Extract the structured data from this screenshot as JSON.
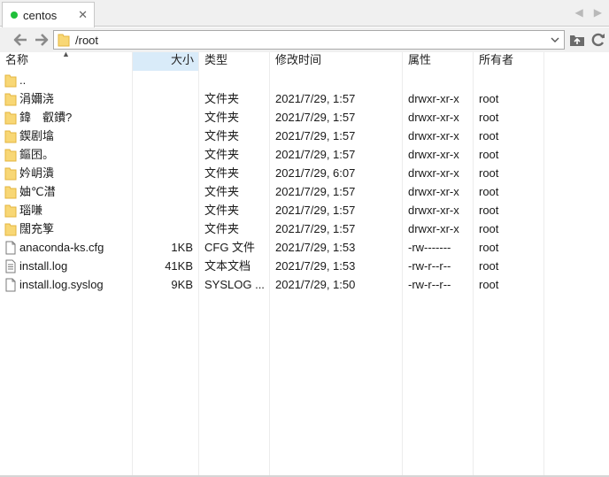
{
  "tab": {
    "title": "centos",
    "close": "✕",
    "status_color": "#1fbf3a"
  },
  "tab_nav": {
    "left": "◀",
    "right": "▶"
  },
  "address": {
    "path": "/root"
  },
  "columns": {
    "name": "名称",
    "size": "大小",
    "type": "类型",
    "mtime": "修改时间",
    "attr": "属性",
    "owner": "所有者"
  },
  "rows": [
    {
      "icon": "folder-icon",
      "name": "..",
      "size": "",
      "type": "",
      "mtime": "",
      "attr": "",
      "owner": ""
    },
    {
      "icon": "folder-icon",
      "name": "涓嬭浇",
      "size": "",
      "type": "文件夹",
      "mtime": "2021/7/29, 1:57",
      "attr": "drwxr-xr-x",
      "owner": "root"
    },
    {
      "icon": "folder-icon",
      "name": "鍏　叡鐨?",
      "size": "",
      "type": "文件夹",
      "mtime": "2021/7/29, 1:57",
      "attr": "drwxr-xr-x",
      "owner": "root"
    },
    {
      "icon": "folder-icon",
      "name": "鍥剧墖",
      "size": "",
      "type": "文件夹",
      "mtime": "2021/7/29, 1:57",
      "attr": "drwxr-xr-x",
      "owner": "root"
    },
    {
      "icon": "folder-icon",
      "name": "鏂囨。",
      "size": "",
      "type": "文件夹",
      "mtime": "2021/7/29, 1:57",
      "attr": "drwxr-xr-x",
      "owner": "root"
    },
    {
      "icon": "folder-icon",
      "name": "妗岄潰",
      "size": "",
      "type": "文件夹",
      "mtime": "2021/7/29, 6:07",
      "attr": "drwxr-xr-x",
      "owner": "root"
    },
    {
      "icon": "folder-icon",
      "name": "妯℃澘",
      "size": "",
      "type": "文件夹",
      "mtime": "2021/7/29, 1:57",
      "attr": "drwxr-xr-x",
      "owner": "root"
    },
    {
      "icon": "folder-icon",
      "name": "瑙嗛",
      "size": "",
      "type": "文件夹",
      "mtime": "2021/7/29, 1:57",
      "attr": "drwxr-xr-x",
      "owner": "root"
    },
    {
      "icon": "folder-icon",
      "name": "闊充箰",
      "size": "",
      "type": "文件夹",
      "mtime": "2021/7/29, 1:57",
      "attr": "drwxr-xr-x",
      "owner": "root"
    },
    {
      "icon": "file-icon",
      "name": "anaconda-ks.cfg",
      "size": "1KB",
      "type": "CFG 文件",
      "mtime": "2021/7/29, 1:53",
      "attr": "-rw-------",
      "owner": "root"
    },
    {
      "icon": "log-file-icon",
      "name": "install.log",
      "size": "41KB",
      "type": "文本文档",
      "mtime": "2021/7/29, 1:53",
      "attr": "-rw-r--r--",
      "owner": "root"
    },
    {
      "icon": "file-icon",
      "name": "install.log.syslog",
      "size": "9KB",
      "type": "SYSLOG ...",
      "mtime": "2021/7/29, 1:50",
      "attr": "-rw-r--r--",
      "owner": "root"
    }
  ]
}
